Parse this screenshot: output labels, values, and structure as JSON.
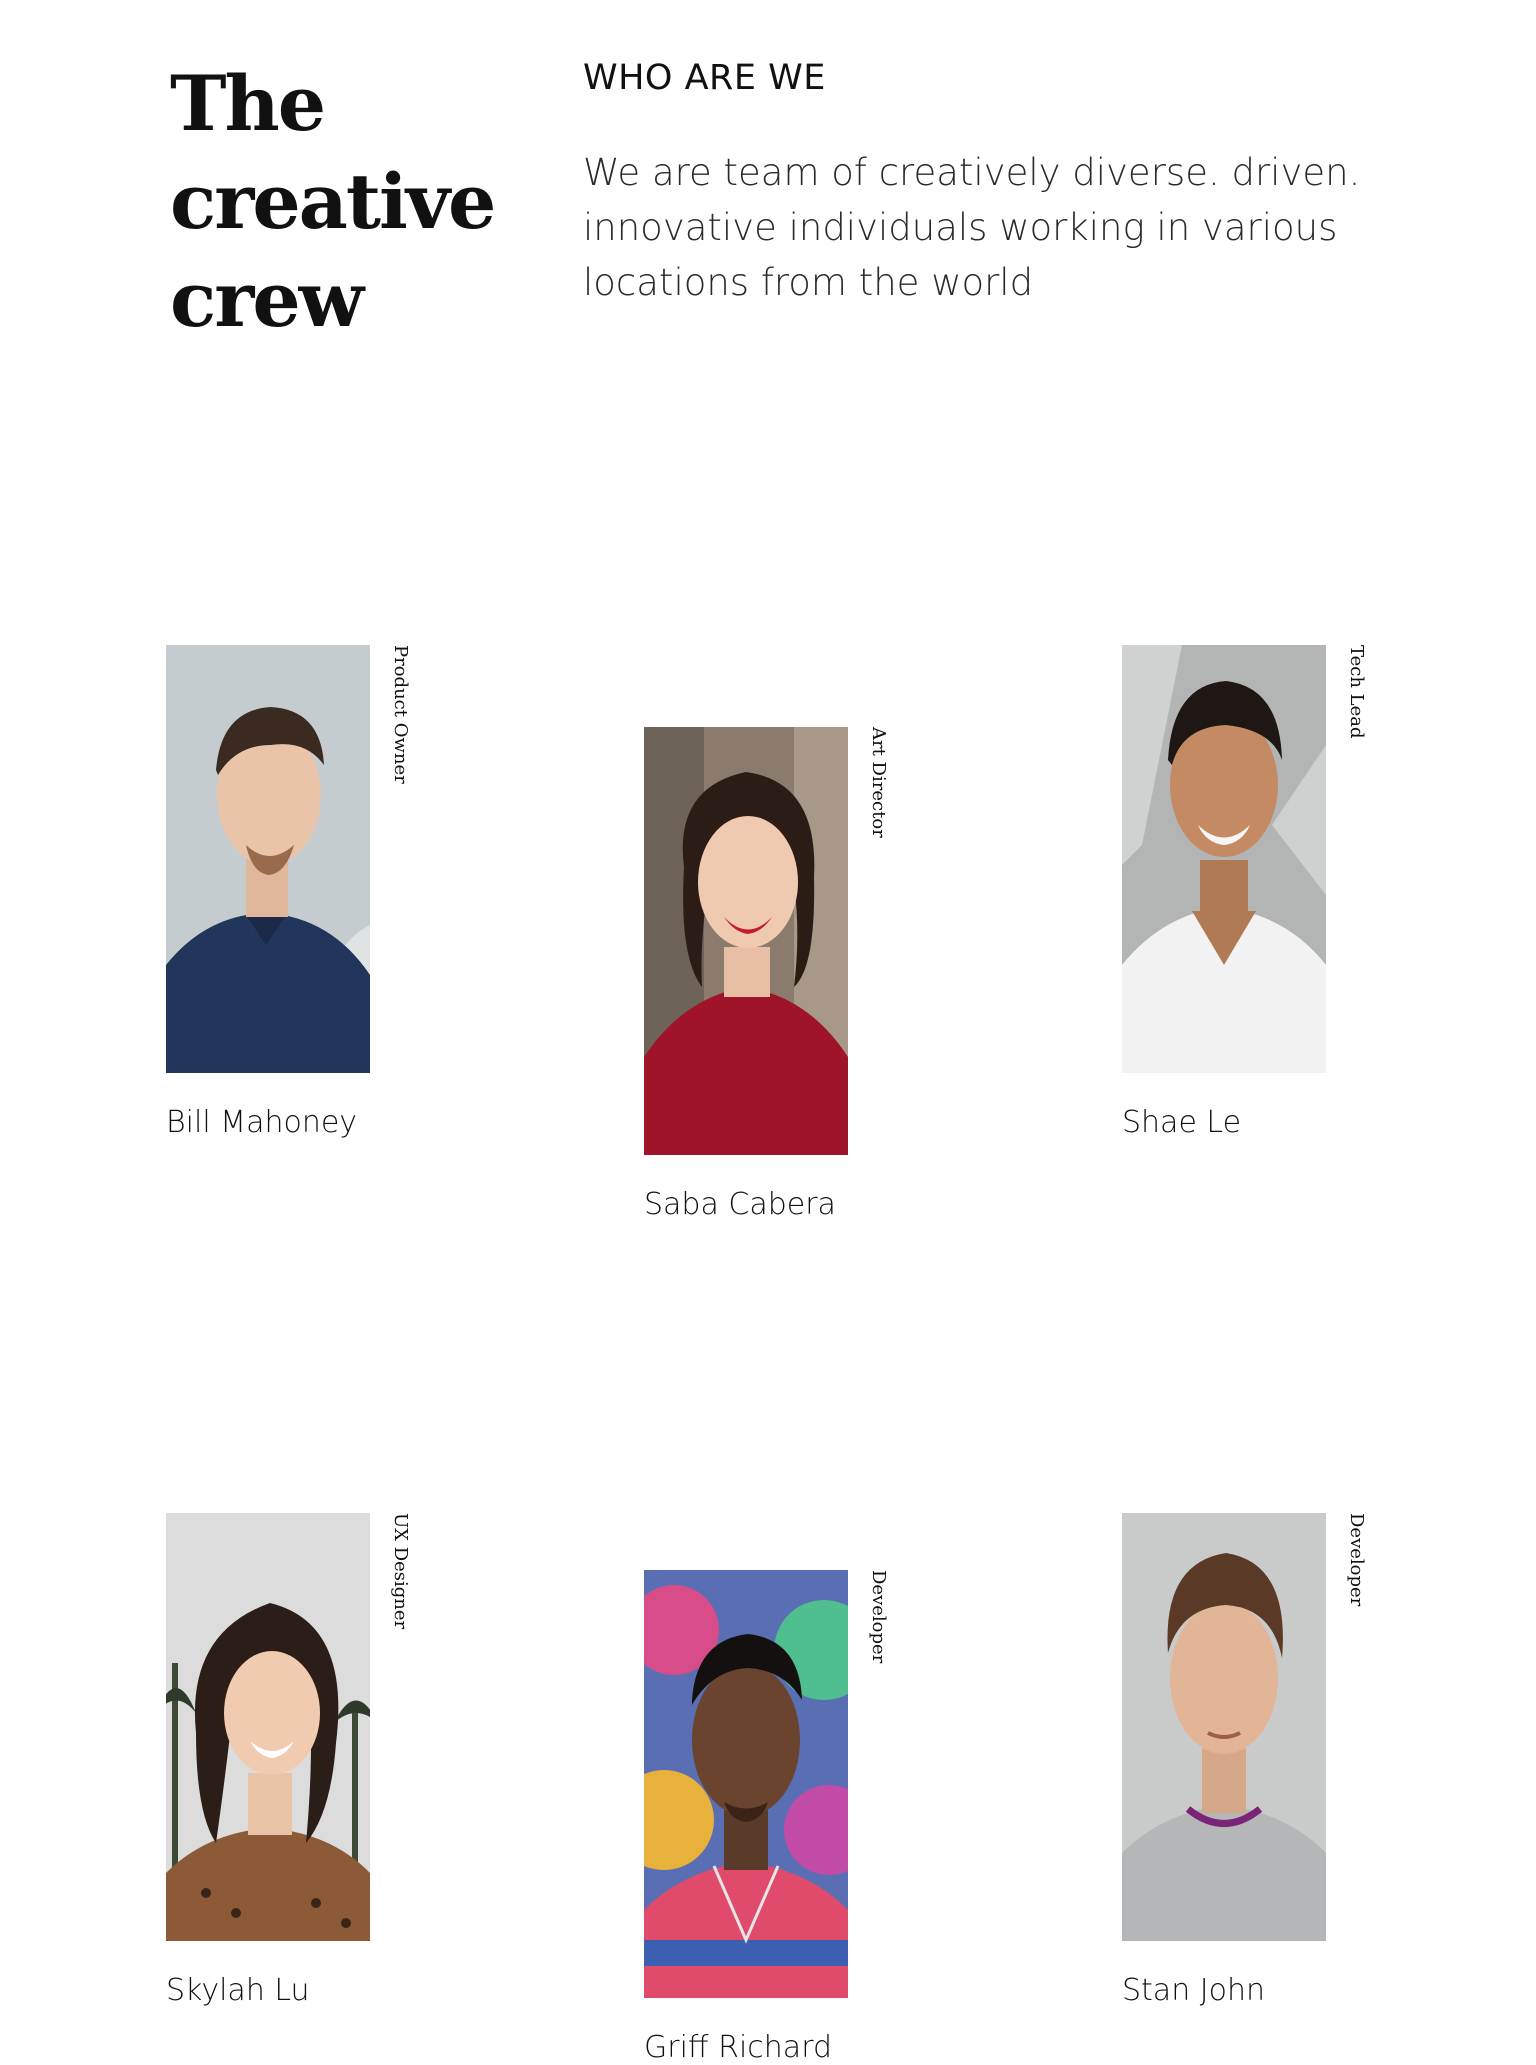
{
  "hero": {
    "title_lines": [
      "The",
      "creative",
      "crew"
    ]
  },
  "about": {
    "heading": "WHO ARE WE",
    "intro": "We are team of creatively diverse. driven. innovative individuals working in various locations from the world"
  },
  "team": [
    {
      "name": "Bill Mahoney",
      "role": "Product Owner",
      "photo": "portrait-man-navy-polo"
    },
    {
      "name": "Saba Cabera",
      "role": "Art Director",
      "photo": "portrait-woman-red-sweater"
    },
    {
      "name": "Shae Le",
      "role": "Tech Lead",
      "photo": "portrait-man-white-tshirt"
    },
    {
      "name": "Skylah Lu",
      "role": "UX Designer",
      "photo": "portrait-woman-leopard-top"
    },
    {
      "name": "Griff Richard",
      "role": "Developer",
      "photo": "portrait-man-graffiti-wall"
    },
    {
      "name": "Stan John",
      "role": "Developer",
      "photo": "portrait-man-grey-sweater"
    }
  ]
}
